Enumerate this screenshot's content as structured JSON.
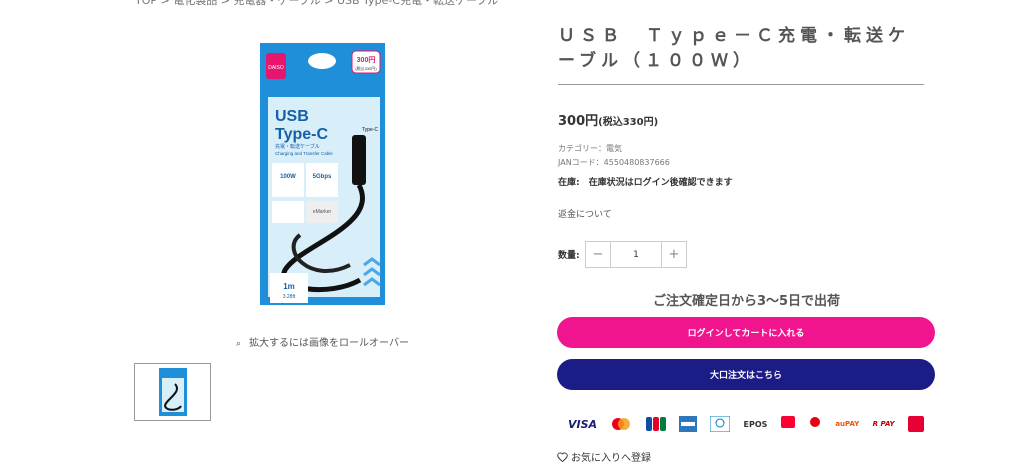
{
  "breadcrumb": "TOP > 電化製品 > 充電器・ケーブル > USB Type-C充電・転送ケーブル",
  "product": {
    "title": "ＵＳＢ　Ｔｙｐｅ－Ｃ充電・転送ケーブル（１００Ｗ）",
    "price": "300円",
    "price_tax": "(税込330円)",
    "category": "カテゴリー：電気",
    "jan": "JANコード：4550480837666",
    "stock": "在庫:　在庫状況はログイン後確認できます",
    "returns": "返金について",
    "qty_label": "数量:",
    "qty_value": "1",
    "qty_minus": "−",
    "qty_plus": "+",
    "delivery": "ご注文確定日から3〜5日で出荷",
    "cart_label": "ログインしてカートに入れる",
    "bulk_label": "大口注文はこちら",
    "favorite_label": "お気に入りへ登録"
  },
  "gallery": {
    "zoom_hint": "拡大するには画像をロールオーバー",
    "package": {
      "brand": "DAISO",
      "price_tag": "300円",
      "price_tag_tax": "(税込330円)",
      "usb": "USB",
      "type_c": "Type-C",
      "jp_sub": "充電・転送ケーブル",
      "en_sub": "Charging and Transfer Cable",
      "watt": "100W",
      "speed": "5Gbps",
      "emarker": "eMarker",
      "length": "1m",
      "length_ft": "3.28ft",
      "plug_label": "Type-C"
    }
  },
  "payments": [
    "VISA",
    "Mastercard",
    "JCB",
    "AMEX",
    "Diners Club",
    "EPOS",
    "PayPay",
    "d払い",
    "au PAY",
    "楽天ペイ",
    "Merpay"
  ],
  "colors": {
    "accent_pink": "#f0158e",
    "navy": "#1c1c86",
    "package_blue": "#1e8fd8"
  }
}
